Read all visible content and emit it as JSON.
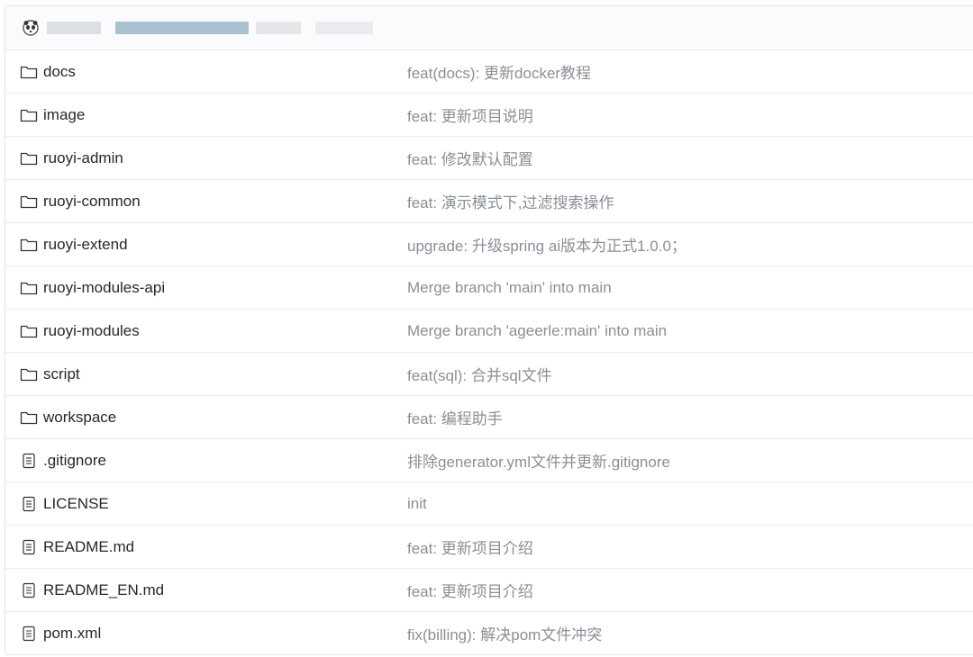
{
  "colors": {
    "name_text": "#24292e",
    "message_text": "#8a8f96",
    "border": "#e1e4e8"
  },
  "files": [
    {
      "name": "docs",
      "type": "folder",
      "icon": "folder-icon",
      "message": "feat(docs): 更新docker教程"
    },
    {
      "name": "image",
      "type": "folder",
      "icon": "folder-icon",
      "message": "feat: 更新项目说明"
    },
    {
      "name": "ruoyi-admin",
      "type": "folder",
      "icon": "folder-icon",
      "message": "feat: 修改默认配置"
    },
    {
      "name": "ruoyi-common",
      "type": "folder",
      "icon": "folder-icon",
      "message": "feat: 演示模式下,过滤搜索操作"
    },
    {
      "name": "ruoyi-extend",
      "type": "folder",
      "icon": "folder-icon",
      "message": "upgrade: 升级spring ai版本为正式1.0.0；"
    },
    {
      "name": "ruoyi-modules-api",
      "type": "folder",
      "icon": "folder-icon",
      "message": "Merge branch 'main' into main"
    },
    {
      "name": "ruoyi-modules",
      "type": "folder",
      "icon": "folder-icon",
      "message": "Merge branch 'ageerle:main' into main"
    },
    {
      "name": "script",
      "type": "folder",
      "icon": "folder-icon",
      "message": "feat(sql): 合并sql文件"
    },
    {
      "name": "workspace",
      "type": "folder",
      "icon": "folder-icon",
      "message": "feat: 编程助手"
    },
    {
      "name": ".gitignore",
      "type": "file",
      "icon": "file-text-icon",
      "message": "排除generator.yml文件并更新.gitignore"
    },
    {
      "name": "LICENSE",
      "type": "file",
      "icon": "file-text-icon",
      "message": "init"
    },
    {
      "name": "README.md",
      "type": "file",
      "icon": "file-text-icon",
      "message": "feat: 更新项目介绍"
    },
    {
      "name": "README_EN.md",
      "type": "file",
      "icon": "file-text-icon",
      "message": "feat: 更新项目介绍"
    },
    {
      "name": "pom.xml",
      "type": "file",
      "icon": "file-text-icon",
      "message": "fix(billing): 解决pom文件冲突"
    }
  ]
}
